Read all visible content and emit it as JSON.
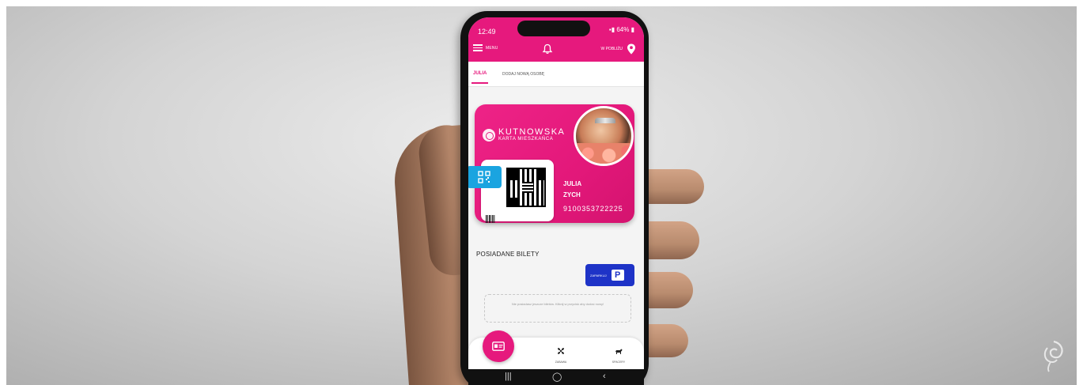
{
  "status_bar": {
    "time": "12:49",
    "battery": "64%"
  },
  "header": {
    "menu_label": "MENU",
    "nearby_label": "W POBLIŻU"
  },
  "tabs": [
    {
      "label": "JULIA",
      "active": true
    },
    {
      "label": "DODAJ NOWĄ OSOBĘ",
      "active": false
    }
  ],
  "card": {
    "brand_name": "KUTNOWSKA",
    "brand_sub": "KARTA MIESZKAŃCA",
    "first_name": "JULIA",
    "last_name": "ZYCH",
    "card_number": "9100353722225"
  },
  "tickets": {
    "heading": "POSIADANE BILETY",
    "parking_label": "ZAPARKUJ",
    "empty_text": "Nie posiadasz jeszcze biletów. Kliknij w przycisk aby dodać nowy!"
  },
  "bottom_nav": {
    "events_label": "ZABAWA",
    "walks_label": "SPACERY"
  },
  "colors": {
    "brand_pink": "#e6197d",
    "parking_blue": "#1e33c7",
    "qr_blue": "#1aa4e0"
  }
}
